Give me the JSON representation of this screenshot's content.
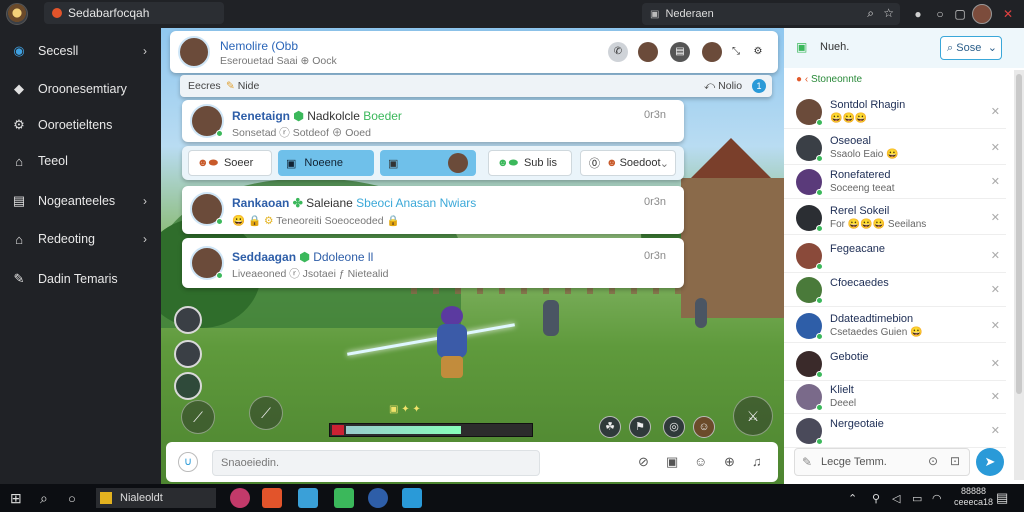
{
  "window": {
    "title": "Sedabarfocqah",
    "address": "Nederaen",
    "colors": {
      "accent": "#2a9ad8",
      "sidebar": "#202226",
      "link": "#233d7a"
    }
  },
  "sidebar": {
    "items": [
      {
        "label": "Secesll",
        "icon": "chat-bubble-icon"
      },
      {
        "label": "Oroonesemtiary",
        "icon": "tag-icon"
      },
      {
        "label": "Ooroetieltens",
        "icon": "gear-icon"
      },
      {
        "label": "Teeol",
        "icon": "home-icon"
      },
      {
        "label": "Nogeanteeles",
        "icon": "bag-icon"
      },
      {
        "label": "Redeoting",
        "icon": "home-icon"
      },
      {
        "label": "Dadin Temaris",
        "icon": "pen-icon"
      }
    ]
  },
  "chat_header": {
    "name": "Nemolire (Obb",
    "status": "Eserouetad Saai ⊕ Oock"
  },
  "sub_header": {
    "left": "Eecres",
    "right_label": "Nolio",
    "filter": "Nide",
    "badge": "1"
  },
  "messages": [
    {
      "name": "Renetaign",
      "extra": "Nadkolcle",
      "highlight": "Boeder",
      "sub": "Sonsetad ⓡ Sotdeof ⊕ Ooed",
      "time": "0r3n"
    },
    {
      "name": "Rankaoan",
      "extra": "Saleiane",
      "highlight": "Sbeoci  Anasan Nwiars",
      "sub": "Teneoreiti Soeoceoded",
      "time": "0r3n"
    },
    {
      "name": "Seddaagan",
      "extra": "",
      "highlight": "Ddoleone ll",
      "sub": "Liveaeoned ⓡ Jsotaei ƒ Nietealid",
      "time": "0r3n"
    }
  ],
  "action_row": {
    "btn1": "Soeer",
    "btn2": "Noeene",
    "btn3": "",
    "btn4": "Sub lis",
    "btn5": "Soedoot"
  },
  "input": {
    "placeholder": "Snaoeiedin."
  },
  "right_panel": {
    "title": "Nueh.",
    "search": "Sose",
    "section": "Stoneonnte",
    "contacts": [
      {
        "name": "Sontdol Rhagin",
        "sub": "😀😀😀"
      },
      {
        "name": "Oseoeal",
        "sub": "Ssaolo Eaio 😀"
      },
      {
        "name": "Ronefatered",
        "sub": "Soceeng teeat"
      },
      {
        "name": "Rerel Sokeil",
        "sub": "For 😀😀😀 Seeilans"
      },
      {
        "name": "Fegeacane",
        "sub": ""
      },
      {
        "name": "Cfoecaedes",
        "sub": ""
      },
      {
        "name": "Ddateadtimebion",
        "sub": "Csetaedes Guien 😀"
      },
      {
        "name": "Gebotie",
        "sub": ""
      },
      {
        "name": "Klielt",
        "sub": "Deeel"
      },
      {
        "name": "Nergeotaie",
        "sub": ""
      }
    ],
    "reply_placeholder": "Lecge Temm."
  },
  "taskbar": {
    "app": "Nialeoldt",
    "time": "88888",
    "date": "ceeeca18"
  },
  "hud": {
    "progress": 0.72
  }
}
